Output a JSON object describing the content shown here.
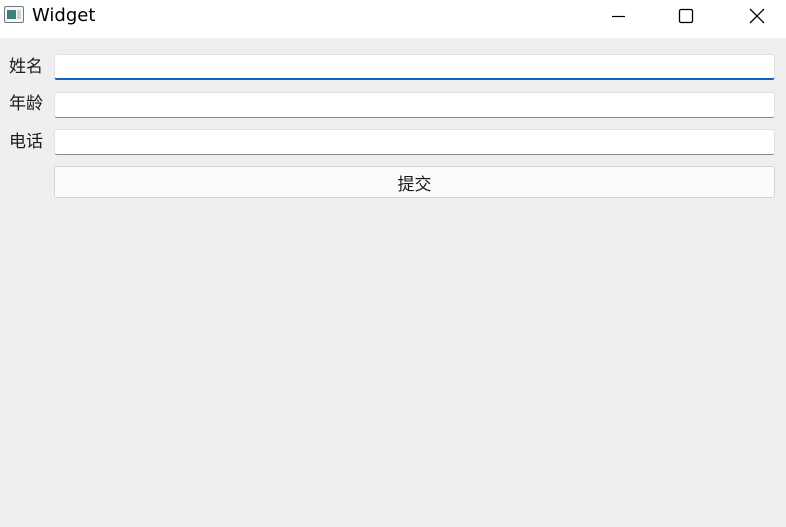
{
  "window": {
    "title": "Widget"
  },
  "form": {
    "name_label": "姓名",
    "age_label": "年龄",
    "phone_label": "电话",
    "name_value": "",
    "age_value": "",
    "phone_value": "",
    "submit_label": "提交"
  },
  "colors": {
    "focus_accent": "#0a63c2",
    "client_background": "#efefef"
  },
  "icons": {
    "app": "window-app-icon",
    "minimize": "minimize-icon",
    "maximize": "maximize-icon",
    "close": "close-icon"
  }
}
